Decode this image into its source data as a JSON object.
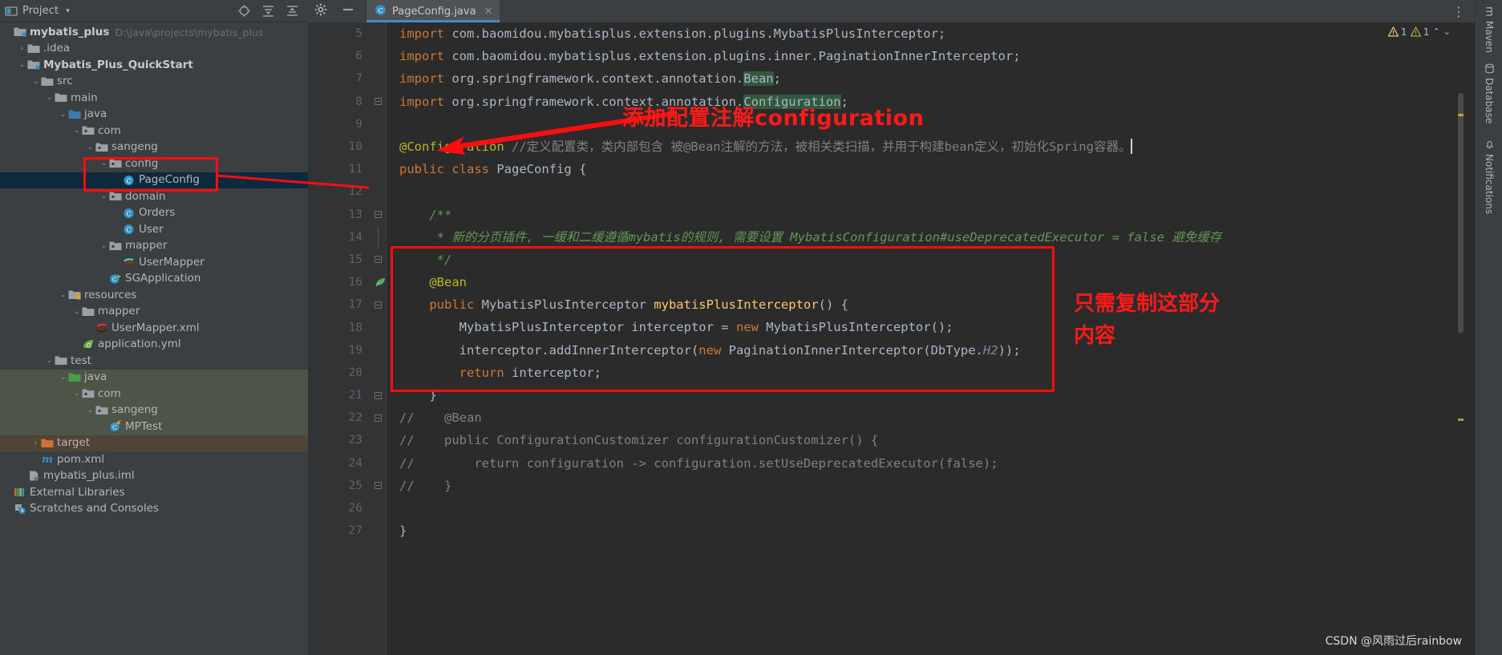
{
  "sidebar": {
    "title": "Project",
    "caret": "▾",
    "actions": [
      "locate-icon",
      "expand-all-icon",
      "collapse-all-icon",
      "settings-icon",
      "hide-icon"
    ],
    "tree": [
      {
        "indent": 0,
        "arrow": "",
        "label": "mybatis_plus",
        "sub": "D:\\Java\\projects\\mybatis_plus",
        "icon": "module-folder",
        "bold": true,
        "bg": "none"
      },
      {
        "indent": 1,
        "arrow": "›",
        "label": ".idea",
        "sub": "",
        "icon": "folder",
        "bold": false,
        "bg": "none"
      },
      {
        "indent": 1,
        "arrow": "⌄",
        "label": "Mybatis_Plus_QuickStart",
        "sub": "",
        "icon": "module-folder",
        "bold": true,
        "bg": "none"
      },
      {
        "indent": 2,
        "arrow": "⌄",
        "label": "src",
        "sub": "",
        "icon": "folder",
        "bold": false,
        "bg": "none"
      },
      {
        "indent": 3,
        "arrow": "⌄",
        "label": "main",
        "sub": "",
        "icon": "folder",
        "bold": false,
        "bg": "none"
      },
      {
        "indent": 4,
        "arrow": "⌄",
        "label": "java",
        "sub": "",
        "icon": "source-folder",
        "bold": false,
        "bg": "none"
      },
      {
        "indent": 5,
        "arrow": "⌄",
        "label": "com",
        "sub": "",
        "icon": "package",
        "bold": false,
        "bg": "none"
      },
      {
        "indent": 6,
        "arrow": "⌄",
        "label": "sangeng",
        "sub": "",
        "icon": "package",
        "bold": false,
        "bg": "none"
      },
      {
        "indent": 7,
        "arrow": "⌄",
        "label": "config",
        "sub": "",
        "icon": "package",
        "bold": false,
        "bg": "none"
      },
      {
        "indent": 8,
        "arrow": "",
        "label": "PageConfig",
        "sub": "",
        "icon": "java-class",
        "bold": false,
        "bg": "selected"
      },
      {
        "indent": 7,
        "arrow": "⌄",
        "label": "domain",
        "sub": "",
        "icon": "package",
        "bold": false,
        "bg": "none"
      },
      {
        "indent": 8,
        "arrow": "",
        "label": "Orders",
        "sub": "",
        "icon": "java-class",
        "bold": false,
        "bg": "none"
      },
      {
        "indent": 8,
        "arrow": "",
        "label": "User",
        "sub": "",
        "icon": "java-class",
        "bold": false,
        "bg": "none"
      },
      {
        "indent": 7,
        "arrow": "⌄",
        "label": "mapper",
        "sub": "",
        "icon": "package",
        "bold": false,
        "bg": "none"
      },
      {
        "indent": 8,
        "arrow": "",
        "label": "UserMapper",
        "sub": "",
        "icon": "mybatis-mapper",
        "bold": false,
        "bg": "none"
      },
      {
        "indent": 7,
        "arrow": "",
        "label": "SGApplication",
        "sub": "",
        "icon": "spring-class",
        "bold": false,
        "bg": "none"
      },
      {
        "indent": 4,
        "arrow": "⌄",
        "label": "resources",
        "sub": "",
        "icon": "resources-folder",
        "bold": false,
        "bg": "none"
      },
      {
        "indent": 5,
        "arrow": "⌄",
        "label": "mapper",
        "sub": "",
        "icon": "folder",
        "bold": false,
        "bg": "none"
      },
      {
        "indent": 6,
        "arrow": "",
        "label": "UserMapper.xml",
        "sub": "",
        "icon": "mybatis-xml",
        "bold": false,
        "bg": "none"
      },
      {
        "indent": 5,
        "arrow": "",
        "label": "application.yml",
        "sub": "",
        "icon": "spring-yml",
        "bold": false,
        "bg": "none"
      },
      {
        "indent": 3,
        "arrow": "⌄",
        "label": "test",
        "sub": "",
        "icon": "folder",
        "bold": false,
        "bg": "none"
      },
      {
        "indent": 4,
        "arrow": "⌄",
        "label": "java",
        "sub": "",
        "icon": "test-source-folder",
        "bold": false,
        "bg": "green"
      },
      {
        "indent": 5,
        "arrow": "⌄",
        "label": "com",
        "sub": "",
        "icon": "package",
        "bold": false,
        "bg": "green"
      },
      {
        "indent": 6,
        "arrow": "⌄",
        "label": "sangeng",
        "sub": "",
        "icon": "package",
        "bold": false,
        "bg": "green"
      },
      {
        "indent": 7,
        "arrow": "",
        "label": "MPTest",
        "sub": "",
        "icon": "test-class",
        "bold": false,
        "bg": "green"
      },
      {
        "indent": 2,
        "arrow": "›",
        "label": "target",
        "sub": "",
        "icon": "excluded-folder",
        "bold": false,
        "bg": "brown"
      },
      {
        "indent": 2,
        "arrow": "",
        "label": "pom.xml",
        "sub": "",
        "icon": "maven-file",
        "bold": false,
        "bg": "none"
      },
      {
        "indent": 1,
        "arrow": "",
        "label": "mybatis_plus.iml",
        "sub": "",
        "icon": "iml-file",
        "bold": false,
        "bg": "none"
      },
      {
        "indent": 0,
        "arrow": "",
        "label": "External Libraries",
        "sub": "",
        "icon": "libraries-icon",
        "bold": false,
        "bg": "none"
      },
      {
        "indent": 0,
        "arrow": "",
        "label": "Scratches and Consoles",
        "sub": "",
        "icon": "scratches-icon",
        "bold": false,
        "bg": "none"
      }
    ]
  },
  "editor": {
    "tab": {
      "label": "PageConfig.java",
      "icon": "java-class-icon",
      "close": "✕"
    },
    "toolbar_icons": [
      "settings-gear-icon",
      "minimize-icon"
    ],
    "inspection": {
      "warnings": "1",
      "weak_warnings": "1",
      "up_arrow": "⌃",
      "down_arrow": "⌄"
    },
    "first_line_number": 5,
    "lines": [
      {
        "n": 5,
        "fold": "none",
        "segs": [
          {
            "t": "import ",
            "c": "kw"
          },
          {
            "t": "com.baomidou.mybatisplus.extension.plugins.MybatisPlusInterceptor;",
            "c": "cls"
          }
        ]
      },
      {
        "n": 6,
        "fold": "none",
        "segs": [
          {
            "t": "import ",
            "c": "kw"
          },
          {
            "t": "com.baomidou.mybatisplus.extension.plugins.inner.PaginationInnerInterceptor;",
            "c": "cls"
          }
        ]
      },
      {
        "n": 7,
        "fold": "none",
        "segs": [
          {
            "t": "import ",
            "c": "kw"
          },
          {
            "t": "org.springframework.context.annotation.",
            "c": "cls"
          },
          {
            "t": "Bean",
            "c": "hl-y"
          },
          {
            "t": ";",
            "c": "cls"
          }
        ]
      },
      {
        "n": 8,
        "fold": "minus",
        "segs": [
          {
            "t": "import ",
            "c": "kw"
          },
          {
            "t": "org.springframework.context.annotation.",
            "c": "cls"
          },
          {
            "t": "Configuration",
            "c": "hl-y"
          },
          {
            "t": ";",
            "c": "cls"
          }
        ]
      },
      {
        "n": 9,
        "fold": "none",
        "segs": []
      },
      {
        "n": 10,
        "fold": "none",
        "segs": [
          {
            "t": "@Configuration ",
            "c": "ann"
          },
          {
            "t": "//定义配置类，类内部包含 被@Bean注解的方法，被相关类扫描，并用于构建bean定义，初始化Spring容器。",
            "c": "cmt"
          }
        ]
      },
      {
        "n": 11,
        "fold": "none",
        "segs": [
          {
            "t": "public ",
            "c": "kw"
          },
          {
            "t": "class ",
            "c": "kw"
          },
          {
            "t": "PageConfig ",
            "c": "cls"
          },
          {
            "t": "{",
            "c": "cls"
          }
        ]
      },
      {
        "n": 12,
        "fold": "none",
        "segs": []
      },
      {
        "n": 13,
        "fold": "minus",
        "segs": [
          {
            "t": "    /**",
            "c": "cmt-green"
          }
        ]
      },
      {
        "n": 14,
        "fold": "bar",
        "segs": [
          {
            "t": "     * 新的分页插件, 一缓和二缓遵循mybatis的规则, 需要设置 MybatisConfiguration#useDeprecatedExecutor = false 避免缓存",
            "c": "cmt-green"
          }
        ]
      },
      {
        "n": 15,
        "fold": "minus",
        "segs": [
          {
            "t": "     */",
            "c": "cmt-green"
          }
        ]
      },
      {
        "n": 16,
        "fold": "none",
        "segs": [
          {
            "t": "    @Bean",
            "c": "ann"
          }
        ],
        "gutter_icon": "bean-icon"
      },
      {
        "n": 17,
        "fold": "minus",
        "segs": [
          {
            "t": "    public ",
            "c": "kw"
          },
          {
            "t": "MybatisPlusInterceptor ",
            "c": "cls"
          },
          {
            "t": "mybatisPlusInterceptor",
            "c": "mth"
          },
          {
            "t": "() {",
            "c": "cls"
          }
        ]
      },
      {
        "n": 18,
        "fold": "none",
        "segs": [
          {
            "t": "        MybatisPlusInterceptor interceptor = ",
            "c": "cls"
          },
          {
            "t": "new ",
            "c": "kw"
          },
          {
            "t": "MybatisPlusInterceptor();",
            "c": "cls"
          }
        ]
      },
      {
        "n": 19,
        "fold": "none",
        "segs": [
          {
            "t": "        interceptor.addInnerInterceptor(",
            "c": "cls"
          },
          {
            "t": "new ",
            "c": "kw"
          },
          {
            "t": "PaginationInnerInterceptor(DbType.",
            "c": "cls"
          },
          {
            "t": "H2",
            "c": "fld"
          },
          {
            "t": "));",
            "c": "cls"
          }
        ]
      },
      {
        "n": 20,
        "fold": "none",
        "segs": [
          {
            "t": "        return ",
            "c": "kw"
          },
          {
            "t": "interceptor;",
            "c": "cls"
          }
        ]
      },
      {
        "n": 21,
        "fold": "minus",
        "segs": [
          {
            "t": "    }",
            "c": "cls"
          }
        ]
      },
      {
        "n": 22,
        "fold": "minus",
        "segs": [
          {
            "t": "//    @Bean",
            "c": "cmt"
          }
        ]
      },
      {
        "n": 23,
        "fold": "none",
        "segs": [
          {
            "t": "//    public ConfigurationCustomizer configurationCustomizer() {",
            "c": "cmt"
          }
        ]
      },
      {
        "n": 24,
        "fold": "none",
        "segs": [
          {
            "t": "//        return configuration -> configuration.setUseDeprecatedExecutor(false);",
            "c": "cmt"
          }
        ]
      },
      {
        "n": 25,
        "fold": "minus",
        "segs": [
          {
            "t": "//    }",
            "c": "cmt"
          }
        ]
      },
      {
        "n": 26,
        "fold": "none",
        "segs": []
      },
      {
        "n": 27,
        "fold": "none",
        "segs": [
          {
            "t": "}",
            "c": "cls"
          }
        ]
      }
    ]
  },
  "annotations": {
    "arrow_note_top": "添加配置注解configuration",
    "side_note_line1": "只需复制这部分",
    "side_note_line2": "内容"
  },
  "rightbar": {
    "items": [
      "Maven",
      "Database",
      "Notifications"
    ]
  },
  "watermark": "CSDN @风雨过后rainbow",
  "colors": {
    "accent_red": "#ff1a1a",
    "tab_underline": "#4a88c7",
    "selection_blue": "#0d293e",
    "test_green": "#4c5548",
    "excluded_brown": "#4f4436"
  }
}
